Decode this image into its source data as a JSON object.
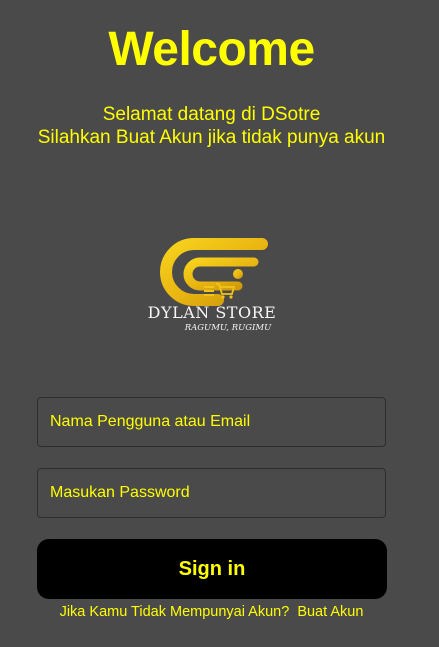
{
  "header": {
    "title": "Welcome",
    "subtitle_line1": "Selamat datang di DSotre",
    "subtitle_line2": "Silahkan Buat Akun jika tidak punya akun"
  },
  "logo": {
    "icon": "dylan-store-logo",
    "brand": "DYLAN STORE",
    "tagline": "RAGUMU, RUGIMU"
  },
  "form": {
    "username_placeholder": "Nama Pengguna atau Email",
    "password_placeholder": "Masukan Password",
    "signin_label": "Sign in"
  },
  "footer": {
    "prompt": "Jika Kamu Tidak Mempunyai Akun?",
    "link_label": "Buat Akun"
  },
  "colors": {
    "background": "#4a4a4a",
    "accent": "#ffff00",
    "button": "#000000",
    "logo_gold": "#f2c418"
  }
}
